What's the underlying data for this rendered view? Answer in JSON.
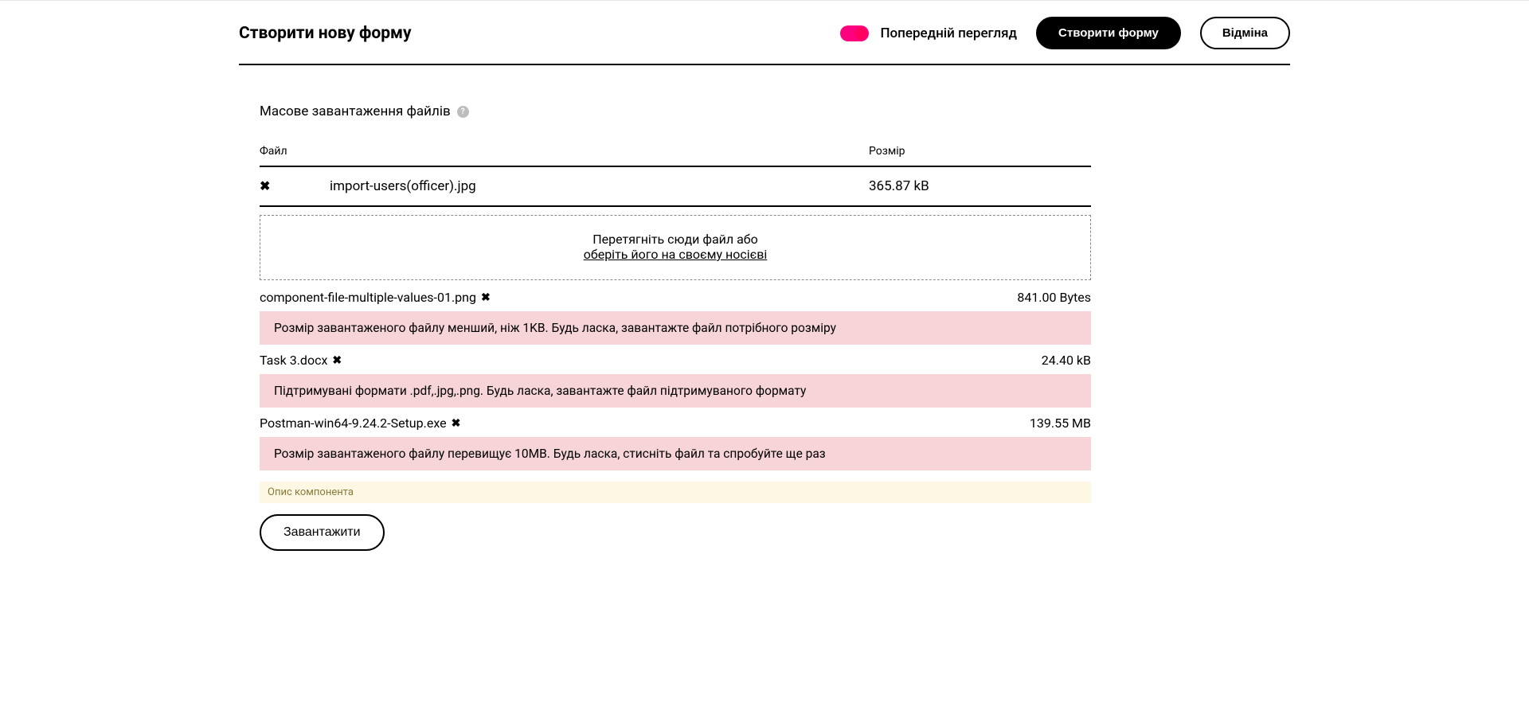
{
  "header": {
    "title": "Створити нову форму",
    "preview_label": "Попередній перегляд",
    "create_button": "Створити форму",
    "cancel_button": "Відміна"
  },
  "section": {
    "title": "Масове завантаження файлів"
  },
  "table": {
    "col_file": "Файл",
    "col_size": "Розмір",
    "rows": [
      {
        "name": "import-users(officer).jpg",
        "size": "365.87 kB"
      }
    ]
  },
  "dropzone": {
    "drag_text": "Перетягніть сюди файл або",
    "link_text": "оберіть його на своєму носієві"
  },
  "error_files": [
    {
      "name": "component-file-multiple-values-01.png",
      "size": "841.00 Bytes",
      "error": "Розмір завантаженого файлу менший, ніж 1KB. Будь ласка, завантажте файл потрібного розміру"
    },
    {
      "name": "Task 3.docx",
      "size": "24.40 kB",
      "error": "Підтримувані формати .pdf,.jpg,.png. Будь ласка, завантажте файл підтримуваного формату"
    },
    {
      "name": "Postman-win64-9.24.2-Setup.exe",
      "size": "139.55 MB",
      "error": "Розмір завантаженого файлу перевищує 10MB. Будь ласка, стисніть файл та спробуйте ще раз"
    }
  ],
  "component_desc": "Опис компонента",
  "download_button": "Завантажити",
  "icons": {
    "remove": "✖",
    "help": "?"
  }
}
